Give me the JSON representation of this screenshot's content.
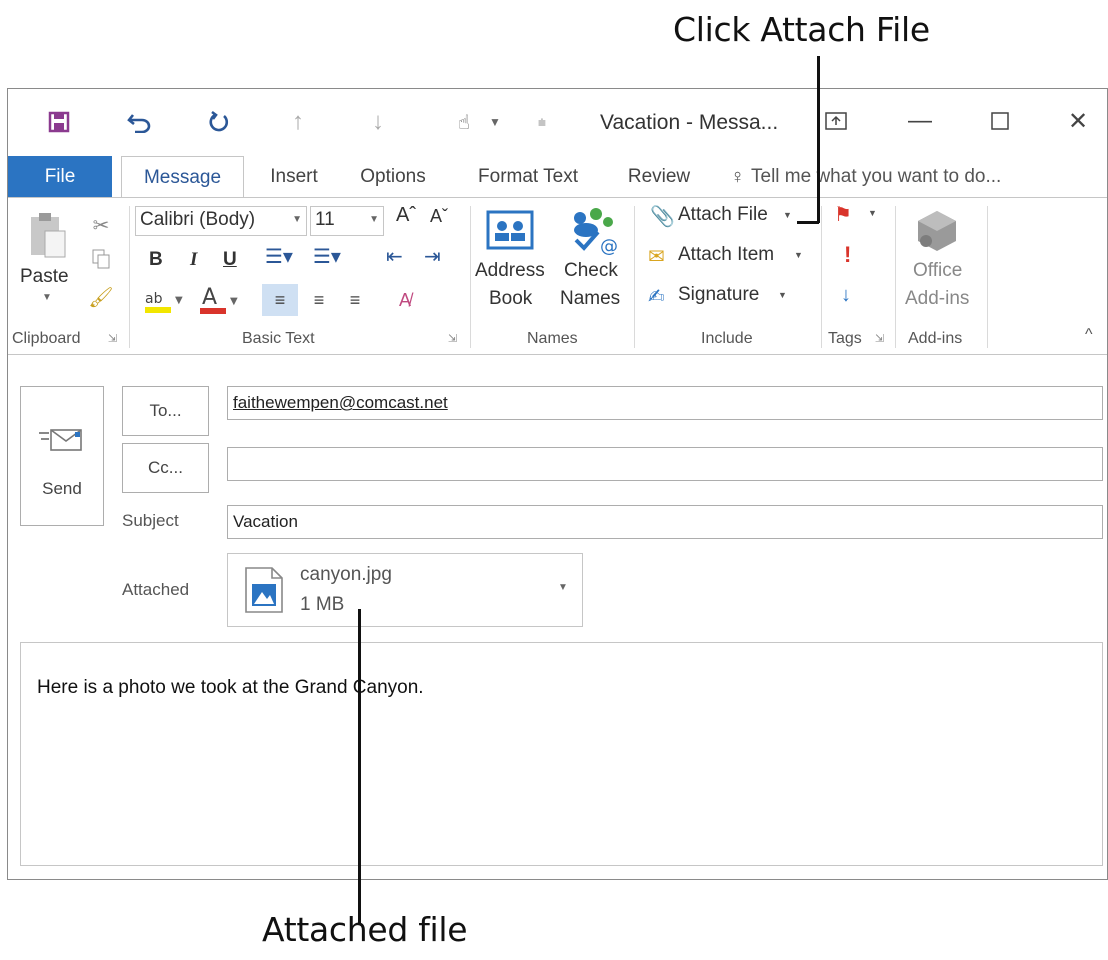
{
  "callouts": {
    "top": "Click Attach File",
    "bottom": "Attached file"
  },
  "window": {
    "title": "Vacation - Messa..."
  },
  "tabs": [
    {
      "label": "File"
    },
    {
      "label": "Message"
    },
    {
      "label": "Insert"
    },
    {
      "label": "Options"
    },
    {
      "label": "Format Text"
    },
    {
      "label": "Review"
    }
  ],
  "tell_me": "Tell me what you want to do...",
  "ribbon": {
    "clipboard": {
      "paste": "Paste",
      "label": "Clipboard"
    },
    "basic_text": {
      "font": "Calibri (Body)",
      "size": "11",
      "bold": "B",
      "italic": "I",
      "underline": "U",
      "label": "Basic Text"
    },
    "names": {
      "address_book": [
        "Address",
        "Book"
      ],
      "check_names": [
        "Check",
        "Names"
      ],
      "label": "Names"
    },
    "include": {
      "attach_file": "Attach File",
      "attach_item": "Attach Item",
      "signature": "Signature",
      "label": "Include"
    },
    "tags": {
      "label": "Tags"
    },
    "addins": {
      "office": [
        "Office",
        "Add-ins"
      ],
      "label": "Add-ins"
    }
  },
  "compose": {
    "send": "Send",
    "to_button": "To...",
    "cc_button": "Cc...",
    "to_value": "faithewempen@comcast.net",
    "cc_value": "",
    "subject_label": "Subject",
    "subject_value": "Vacation",
    "attached_label": "Attached",
    "attachment": {
      "name": "canyon.jpg",
      "size": "1 MB"
    },
    "body": "Here is a photo we took at the Grand Canyon."
  },
  "colors": {
    "file_tab": "#2b74c2",
    "save_icon": "#8b3a8f",
    "accent_blue": "#2b74c2",
    "flag_red": "#d9342b"
  }
}
